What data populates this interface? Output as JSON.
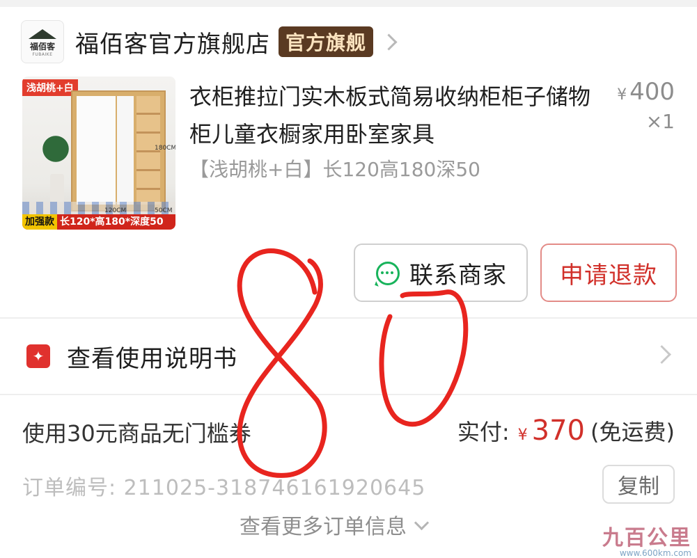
{
  "store": {
    "logo_text": "福佰客",
    "logo_sub": "FUBAIKE",
    "name": "福佰客官方旗舰店",
    "badge": "官方旗舰"
  },
  "product": {
    "title": "衣柜推拉门实木板式简易收纳柜柜子储物柜儿童衣橱家用卧室家具",
    "spec": "【浅胡桃+白】长120高180深50",
    "price_symbol": "¥",
    "price": "400",
    "quantity": "×1",
    "image": {
      "tag": "浅胡桃+白",
      "strip_left": "加强款",
      "strip_right": "长120*高180*深度50",
      "dim_width": "120CM",
      "dim_height": "180CM",
      "dim_depth": "50CM"
    }
  },
  "actions": {
    "contact_label": "联系商家",
    "refund_label": "申请退款"
  },
  "manual": {
    "label": "查看使用说明书"
  },
  "payment": {
    "coupon": "使用30元商品无门槛券",
    "paid_label": "实付:",
    "currency": "¥",
    "amount": "370",
    "shipping": "(免运费)"
  },
  "order": {
    "label": "订单编号:",
    "number": "211025-318746161920645",
    "copy_label": "复制"
  },
  "more": {
    "label": "查看更多订单信息"
  },
  "annotation": {
    "text": "80",
    "color": "#e8251f"
  },
  "watermark": {
    "name": "九百公里",
    "url": "www.600km.com"
  }
}
